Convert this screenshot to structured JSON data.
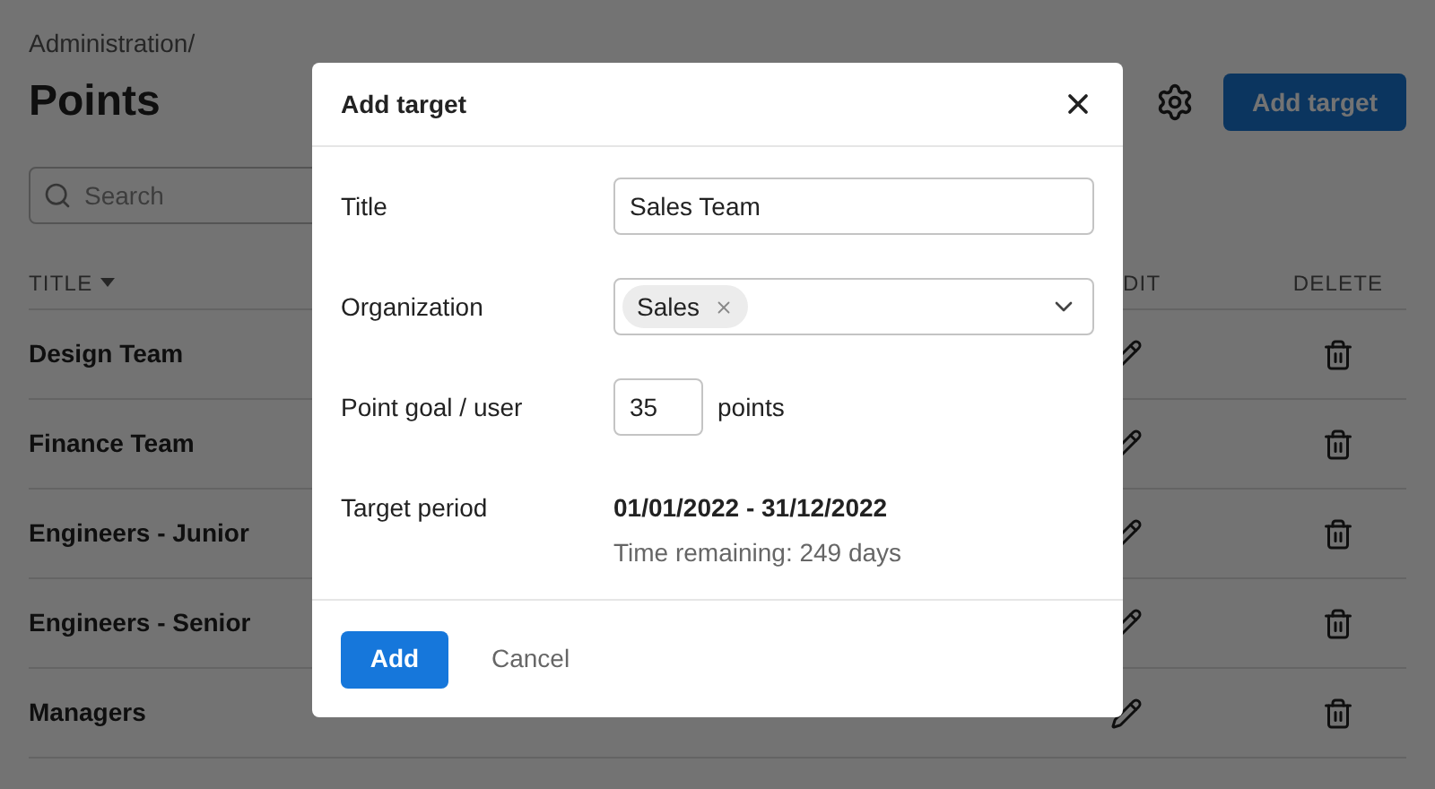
{
  "page": {
    "breadcrumb": "Administration/",
    "title": "Points",
    "add_button": "Add target",
    "search": {
      "placeholder": "Search"
    }
  },
  "table": {
    "columns": [
      {
        "label": "TITLE",
        "sorted": true
      },
      {
        "label": "DIT",
        "sorted": false
      },
      {
        "label": "DELETE",
        "sorted": false
      }
    ],
    "rows": [
      {
        "title": "Design Team"
      },
      {
        "title": "Finance Team"
      },
      {
        "title": "Engineers - Junior"
      },
      {
        "title": "Engineers - Senior"
      },
      {
        "title": "Managers"
      }
    ]
  },
  "dialog": {
    "title": "Add target",
    "fields": [
      {
        "kind": "text",
        "label": "Title",
        "value": "Sales Team"
      },
      {
        "kind": "tags",
        "label": "Organization",
        "tags": [
          "Sales"
        ]
      },
      {
        "kind": "number",
        "label": "Point goal / user",
        "value": "35",
        "unit": "points"
      },
      {
        "kind": "period",
        "label": "Target period",
        "value": "01/01/2022 - 31/12/2022",
        "note": "Time remaining: 249 days"
      }
    ],
    "primary": "Add",
    "secondary": "Cancel"
  }
}
